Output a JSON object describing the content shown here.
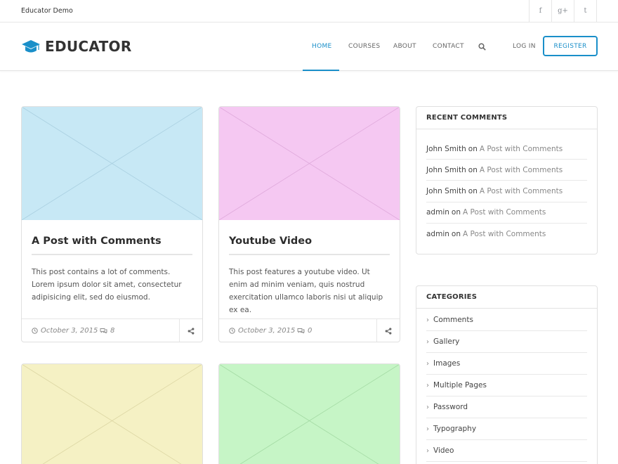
{
  "site": {
    "name": "Educator Demo"
  },
  "social": [
    {
      "icon": "facebook-icon",
      "glyph": "f"
    },
    {
      "icon": "google-plus-icon",
      "glyph": "g+"
    },
    {
      "icon": "twitter-icon",
      "glyph": "t"
    }
  ],
  "header": {
    "logo_text": "EDUCATOR",
    "nav": [
      "HOME",
      "COURSES",
      "ABOUT",
      "CONTACT"
    ],
    "login": "LOG IN",
    "register": "REGISTER"
  },
  "colors": {
    "accent": "#1a8fc9",
    "thumb_blue": "#c7e8f5",
    "thumb_pink": "#f5c8f2",
    "thumb_yellow": "#f5f1c4",
    "thumb_green": "#c6f5c6"
  },
  "posts": [
    {
      "title": "A Post with Comments",
      "excerpt": "This post contains a lot of comments. Lorem ipsum dolor sit amet, consectetur adipisicing elit, sed do eiusmod.",
      "date": "October 3, 2015",
      "comments": "8"
    },
    {
      "title": "Youtube Video",
      "excerpt": "This post features a youtube video. Ut enim ad minim veniam, quis nostrud exercitation ullamco laboris nisi ut aliquip ex ea.",
      "date": "October 3, 2015",
      "comments": "0"
    }
  ],
  "sidebar": {
    "recent_comments": {
      "title": "RECENT COMMENTS",
      "on": "on",
      "items": [
        {
          "author": "John Smith",
          "post": "A Post with Comments"
        },
        {
          "author": "John Smith",
          "post": "A Post with Comments"
        },
        {
          "author": "John Smith",
          "post": "A Post with Comments"
        },
        {
          "author": "admin",
          "post": "A Post with Comments"
        },
        {
          "author": "admin",
          "post": "A Post with Comments"
        }
      ]
    },
    "categories": {
      "title": "CATEGORIES",
      "items": [
        "Comments",
        "Gallery",
        "Images",
        "Multiple Pages",
        "Password",
        "Typography",
        "Video"
      ]
    }
  }
}
